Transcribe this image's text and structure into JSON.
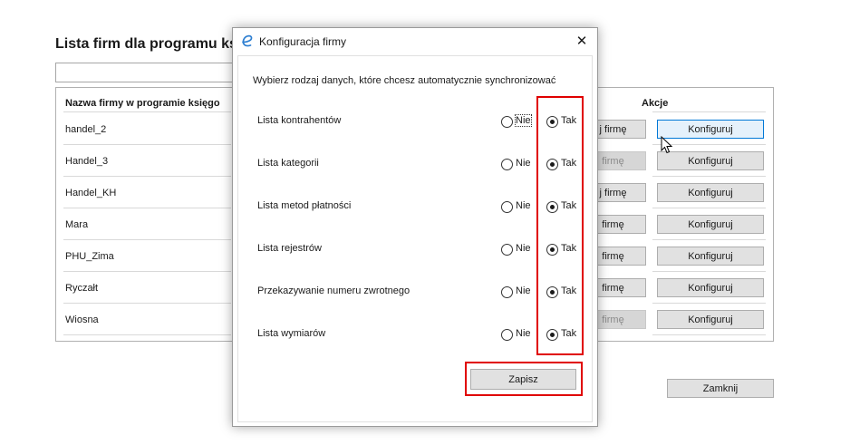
{
  "background": {
    "title": "Lista firm dla programu ks",
    "col_name": "Nazwa firmy w programie księgo",
    "col_actions": "Akcje",
    "rows": [
      {
        "name": "handel_2",
        "left_label": "j firmę",
        "left_disabled": false,
        "config_label": "Konfiguruj"
      },
      {
        "name": "Handel_3",
        "left_label": "firmę",
        "left_disabled": true,
        "config_label": "Konfiguruj"
      },
      {
        "name": "Handel_KH",
        "left_label": "j firmę",
        "left_disabled": false,
        "config_label": "Konfiguruj"
      },
      {
        "name": "Mara",
        "left_label": "firmę",
        "left_disabled": false,
        "config_label": "Konfiguruj"
      },
      {
        "name": "PHU_Zima",
        "left_label": "firmę",
        "left_disabled": false,
        "config_label": "Konfiguruj"
      },
      {
        "name": "Ryczałt",
        "left_label": "firmę",
        "left_disabled": false,
        "config_label": "Konfiguruj"
      },
      {
        "name": "Wiosna",
        "left_label": "firmę",
        "left_disabled": true,
        "config_label": "Konfiguruj"
      }
    ],
    "close_label": "Zamknij"
  },
  "dialog": {
    "title": "Konfiguracja firmy",
    "close_glyph": "✕",
    "intro": "Wybierz rodzaj danych, które chcesz automatycznie synchronizować",
    "options": [
      {
        "label": "Lista kontrahentów",
        "no": "Nie",
        "yes": "Tak",
        "selected": "Tak"
      },
      {
        "label": "Lista kategorii",
        "no": "Nie",
        "yes": "Tak",
        "selected": "Tak"
      },
      {
        "label": "Lista metod płatności",
        "no": "Nie",
        "yes": "Tak",
        "selected": "Tak"
      },
      {
        "label": "Lista rejestrów",
        "no": "Nie",
        "yes": "Tak",
        "selected": "Tak"
      },
      {
        "label": "Przekazywanie numeru zwrotnego",
        "no": "Nie",
        "yes": "Tak",
        "selected": "Tak"
      },
      {
        "label": "Lista wymiarów",
        "no": "Nie",
        "yes": "Tak",
        "selected": "Tak"
      }
    ],
    "save_label": "Zapisz",
    "highlight_color": "#e00000"
  }
}
